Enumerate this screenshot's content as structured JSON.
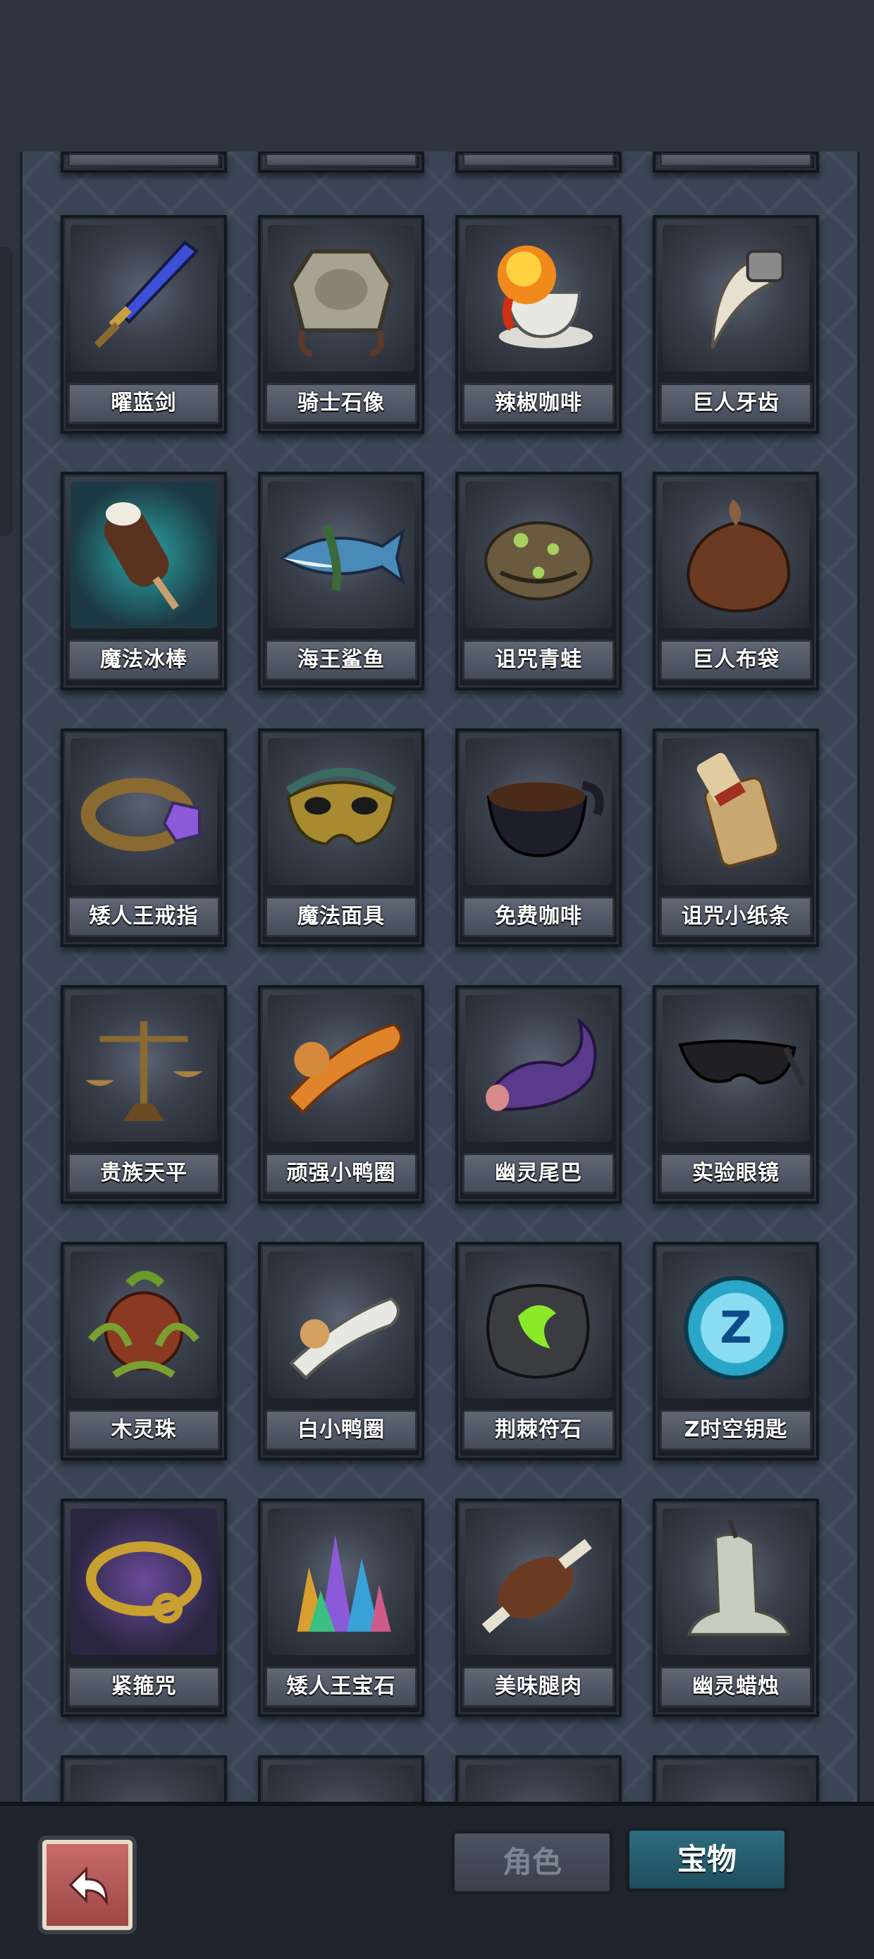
{
  "items": [
    {
      "name": "曜蓝剑",
      "icon": "blue-sword-icon"
    },
    {
      "name": "骑士石像",
      "icon": "stone-statue-icon"
    },
    {
      "name": "辣椒咖啡",
      "icon": "chili-coffee-icon"
    },
    {
      "name": "巨人牙齿",
      "icon": "giant-tooth-icon"
    },
    {
      "name": "魔法冰棒",
      "icon": "magic-popsicle-icon"
    },
    {
      "name": "海王鲨鱼",
      "icon": "shark-icon"
    },
    {
      "name": "诅咒青蛙",
      "icon": "cursed-frog-icon"
    },
    {
      "name": "巨人布袋",
      "icon": "giant-sack-icon"
    },
    {
      "name": "矮人王戒指",
      "icon": "dwarf-ring-icon"
    },
    {
      "name": "魔法面具",
      "icon": "magic-mask-icon"
    },
    {
      "name": "免费咖啡",
      "icon": "free-coffee-icon"
    },
    {
      "name": "诅咒小纸条",
      "icon": "cursed-scroll-icon"
    },
    {
      "name": "贵族天平",
      "icon": "scale-icon"
    },
    {
      "name": "顽强小鸭圈",
      "icon": "orange-duck-ring-icon"
    },
    {
      "name": "幽灵尾巴",
      "icon": "ghost-tail-icon"
    },
    {
      "name": "实验眼镜",
      "icon": "goggles-icon"
    },
    {
      "name": "木灵珠",
      "icon": "wood-orb-icon"
    },
    {
      "name": "白小鸭圈",
      "icon": "white-duck-ring-icon"
    },
    {
      "name": "荆棘符石",
      "icon": "rune-stone-icon"
    },
    {
      "name": "Z时空钥匙",
      "icon": "time-key-icon"
    },
    {
      "name": "紧箍咒",
      "icon": "golden-band-icon"
    },
    {
      "name": "矮人王宝石",
      "icon": "crystal-icon"
    },
    {
      "name": "美味腿肉",
      "icon": "meat-leg-icon"
    },
    {
      "name": "幽灵蜡烛",
      "icon": "ghost-candle-icon"
    }
  ],
  "tabs": {
    "role": "角色",
    "treasure": "宝物"
  },
  "back_icon": "back-arrow-icon"
}
